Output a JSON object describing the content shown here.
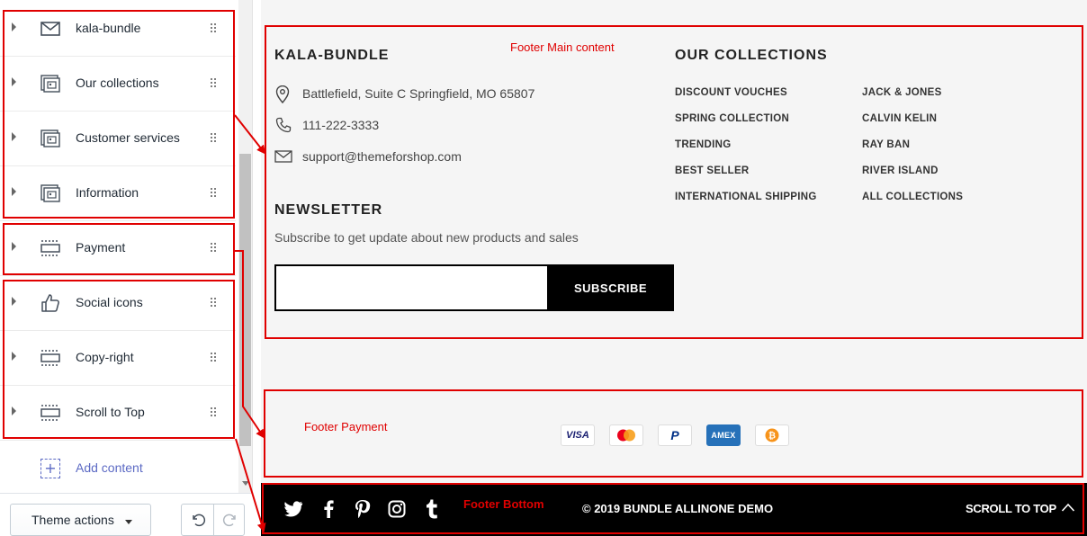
{
  "sidebar": {
    "items": [
      {
        "label": "kala-bundle",
        "icon": "envelope-icon"
      },
      {
        "label": "Our collections",
        "icon": "collection-icon"
      },
      {
        "label": "Customer services",
        "icon": "collection-icon"
      },
      {
        "label": "Information",
        "icon": "collection-icon"
      },
      {
        "label": "Payment",
        "icon": "section-icon"
      },
      {
        "label": "Social icons",
        "icon": "thumbs-up-icon"
      },
      {
        "label": "Copy-right",
        "icon": "section-icon"
      },
      {
        "label": "Scroll to Top",
        "icon": "section-icon"
      }
    ],
    "add_content": "Add content",
    "theme_actions": "Theme actions"
  },
  "preview": {
    "brand_heading": "KALA-BUNDLE",
    "address": "Battlefield, Suite C Springfield, MO 65807",
    "phone": "111-222-3333",
    "email": "support@themeforshop.com",
    "collections_heading": "OUR COLLECTIONS",
    "collections_left": [
      "DISCOUNT VOUCHES",
      "SPRING COLLECTION",
      "TRENDING",
      "BEST SELLER",
      "INTERNATIONAL SHIPPING"
    ],
    "collections_right": [
      "JACK & JONES",
      "CALVIN KELIN",
      "RAY BAN",
      "RIVER ISLAND",
      "ALL COLLECTIONS"
    ],
    "newsletter_heading": "NEWSLETTER",
    "newsletter_text": "Subscribe to get update about new products and sales",
    "subscribe_label": "SUBSCRIBE",
    "payments": [
      "VISA",
      "Mastercard",
      "PayPal",
      "AMEX",
      "Bitcoin"
    ],
    "social": [
      "twitter-icon",
      "facebook-icon",
      "pinterest-icon",
      "instagram-icon",
      "tumblr-icon"
    ],
    "copyright": "© 2019 BUNDLE ALLINONE DEMO",
    "scroll_to_top": "SCROLL TO TOP"
  },
  "annotations": {
    "main": "Footer Main content",
    "payment": "Footer Payment",
    "bottom": "Footer Bottom"
  },
  "colors": {
    "annotation": "#e00000",
    "accent": "#5c6ac4",
    "preview_bg": "#f5f5f5",
    "footer_bottom_bg": "#000000"
  }
}
